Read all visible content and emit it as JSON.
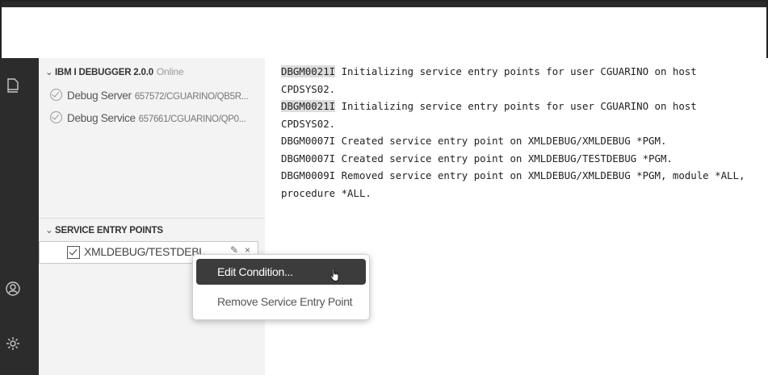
{
  "debugger": {
    "title": "IBM I DEBUGGER 2.0.0",
    "status": "Online",
    "items": [
      {
        "label": "Debug Server",
        "detail": "657572/CGUARINO/QB5R..."
      },
      {
        "label": "Debug Service",
        "detail": "657661/CGUARINO/QP0..."
      }
    ]
  },
  "entry_points": {
    "title": "SERVICE ENTRY POINTS",
    "row_label": "XMLDEBUG/TESTDEBUG *P...",
    "row_checked": true
  },
  "context_menu": {
    "items": [
      {
        "label": "Edit Condition...",
        "active": true
      },
      {
        "label": "Remove Service Entry Point",
        "active": false
      }
    ]
  },
  "console": {
    "lines": [
      {
        "code": "DBGM0021I",
        "text": " Initializing service entry points for user CGUARINO on host",
        "highlight": true
      },
      {
        "code": "",
        "text": "CPDSYS02.",
        "highlight": false
      },
      {
        "code": "DBGM0021I",
        "text": " Initializing service entry points for user CGUARINO on host",
        "highlight": true
      },
      {
        "code": "",
        "text": "CPDSYS02.",
        "highlight": false
      },
      {
        "code": "",
        "text": "DBGM0007I Created service entry point on XMLDEBUG/XMLDEBUG *PGM.",
        "highlight": false
      },
      {
        "code": "",
        "text": "DBGM0007I Created service entry point on XMLDEBUG/TESTDEBUG *PGM.",
        "highlight": false
      },
      {
        "code": "",
        "text": "DBGM0009I Removed service entry point on XMLDEBUG/XMLDEBUG *PGM, module *ALL,",
        "highlight": false
      },
      {
        "code": "",
        "text": "procedure *ALL.",
        "highlight": false
      }
    ]
  },
  "icons": {
    "explorer": "files-icon",
    "account": "account-icon",
    "settings": "gear-icon",
    "chevron": "chevron-down-icon",
    "edit": "pencil-icon",
    "close": "close-icon",
    "pointer": "hand-pointer-icon"
  }
}
